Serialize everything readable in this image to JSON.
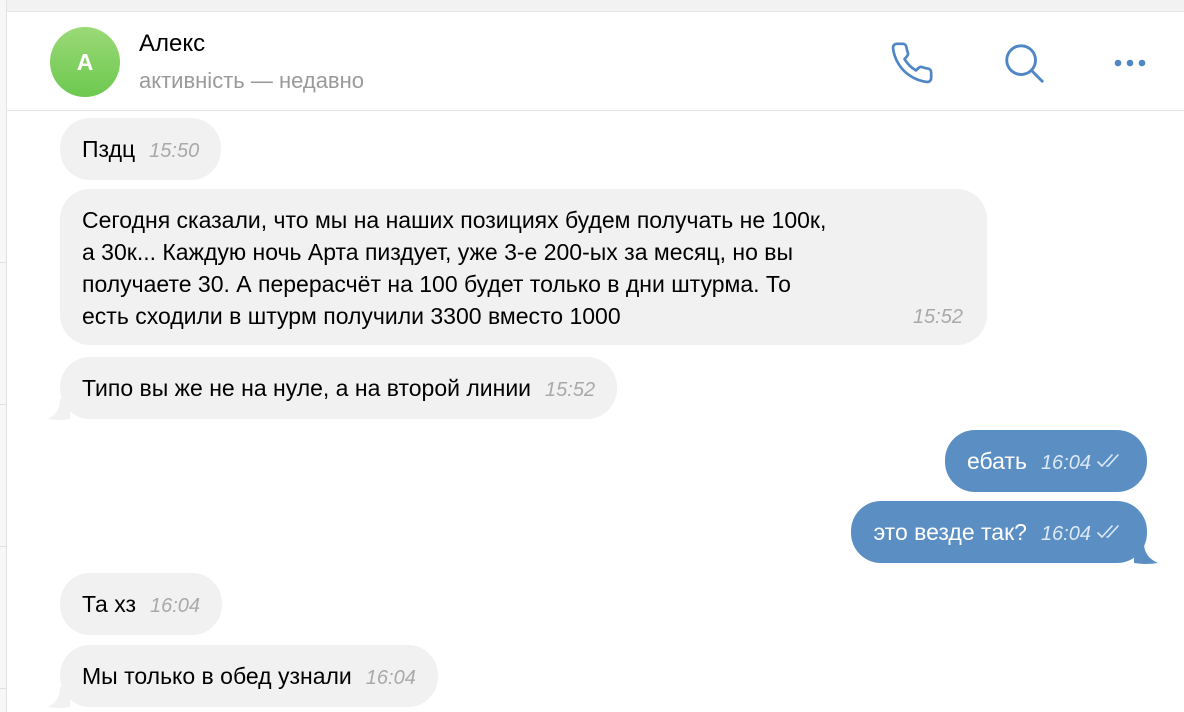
{
  "header": {
    "avatar_letter": "А",
    "contact_name": "Алекс",
    "status": "активність — недавно",
    "avatar_color": "#7dcf5c",
    "accent_color": "#4f86c6",
    "icons": [
      "phone-icon",
      "search-icon",
      "more-icon"
    ]
  },
  "messages": [
    {
      "direction": "in",
      "text": "Пздц",
      "time": "15:50"
    },
    {
      "direction": "in",
      "text": "Сегодня сказали, что мы на наших позициях будем получать не 100к,\nа 30к... Каждую ночь Арта пиздует, уже 3-е 200-ых за месяц, но вы\nполучаете 30. А перерасчёт на 100 будет только в дни штурма. То\nесть сходили в штурм получили 3300 вместо 1000",
      "time": "15:52"
    },
    {
      "direction": "in",
      "text": "Типо вы же не на нуле, а на второй линии",
      "time": "15:52"
    },
    {
      "direction": "out",
      "text": "ебать",
      "time": "16:04",
      "status_icon": "double-check-icon"
    },
    {
      "direction": "out",
      "text": "это везде так?",
      "time": "16:04",
      "status_icon": "double-check-icon"
    },
    {
      "direction": "in",
      "text": "Та хз",
      "time": "16:04"
    },
    {
      "direction": "in",
      "text": "Мы только в обед узнали",
      "time": "16:04"
    }
  ]
}
